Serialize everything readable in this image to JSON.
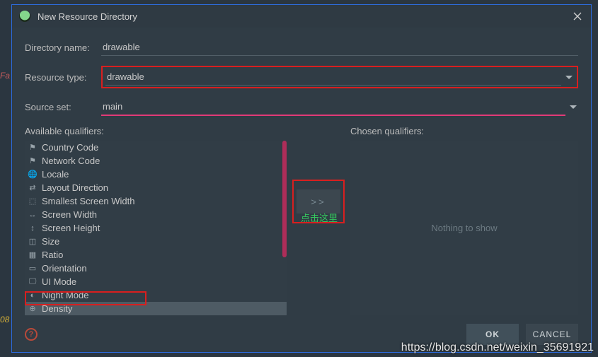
{
  "dialog": {
    "title": "New Resource Directory"
  },
  "form": {
    "directory_name_label": "Directory name:",
    "directory_name_value": "drawable",
    "resource_type_label": "Resource type:",
    "resource_type_value": "drawable",
    "source_set_label": "Source set:",
    "source_set_value": "main"
  },
  "qualifiers": {
    "available_header": "Available qualifiers:",
    "chosen_header": "Chosen qualifiers:",
    "nothing_text": "Nothing to show",
    "items": [
      {
        "icon": "country-code-icon",
        "glyph": "⚑",
        "label": "Country Code"
      },
      {
        "icon": "network-code-icon",
        "glyph": "⚑",
        "label": "Network Code"
      },
      {
        "icon": "locale-icon",
        "glyph": "🌐",
        "label": "Locale"
      },
      {
        "icon": "layout-direction-icon",
        "glyph": "⇄",
        "label": "Layout Direction"
      },
      {
        "icon": "smallest-width-icon",
        "glyph": "⬚",
        "label": "Smallest Screen Width"
      },
      {
        "icon": "screen-width-icon",
        "glyph": "↔",
        "label": "Screen Width"
      },
      {
        "icon": "screen-height-icon",
        "glyph": "↕",
        "label": "Screen Height"
      },
      {
        "icon": "size-icon",
        "glyph": "◫",
        "label": "Size"
      },
      {
        "icon": "ratio-icon",
        "glyph": "▦",
        "label": "Ratio"
      },
      {
        "icon": "orientation-icon",
        "glyph": "▭",
        "label": "Orientation"
      },
      {
        "icon": "ui-mode-icon",
        "glyph": "🖵",
        "label": "UI Mode"
      },
      {
        "icon": "night-mode-icon",
        "glyph": "◐",
        "label": "Night Mode"
      },
      {
        "icon": "density-icon",
        "glyph": "⊕",
        "label": "Density",
        "selected": true
      }
    ],
    "move_right": ">>",
    "click_hint": "点击这里"
  },
  "footer": {
    "help": "?",
    "ok": "OK",
    "cancel": "CANCEL"
  },
  "watermark": "https://blog.csdn.net/weixin_35691921",
  "side": {
    "fa": "Fa",
    "n08": "08"
  }
}
